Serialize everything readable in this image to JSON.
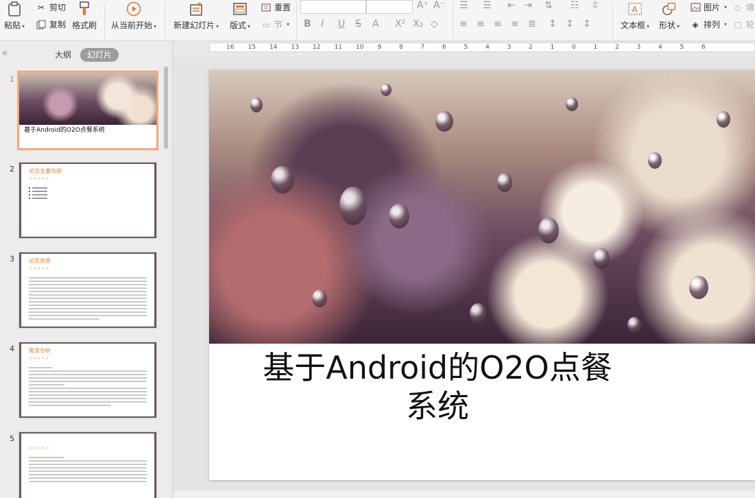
{
  "ribbon": {
    "paste": "粘贴",
    "cut": "剪切",
    "copy": "复制",
    "format_painter": "格式刷",
    "from_current": "从当前开始",
    "new_slide": "新建幻灯片",
    "layout": "版式",
    "reset": "重置",
    "section": "节",
    "font_size_up": "A⁺",
    "font_size_down": "A⁻",
    "text_box": "文本框",
    "shape": "形状",
    "picture": "图片",
    "arrange": "排列",
    "fill_cut": "填",
    "outline_cut": "轮"
  },
  "left_pane": {
    "tab_outline": "大纲",
    "tab_slides": "幻灯片",
    "slides": [
      {
        "num": "1",
        "title": "基于Android的O2O点餐系统"
      },
      {
        "num": "2",
        "title": "论文主要内容",
        "arrows": ">>>>>",
        "bullets": 4
      },
      {
        "num": "3",
        "title": "论文背景",
        "arrows": ">>>>>"
      },
      {
        "num": "4",
        "title": "需求分析",
        "arrows": ">>>>>"
      },
      {
        "num": "5",
        "title": "",
        "arrows": ">>>>>"
      }
    ]
  },
  "ruler": [
    "16",
    "15",
    "14",
    "13",
    "12",
    "11",
    "10",
    "9",
    "8",
    "7",
    "6",
    "5",
    "4",
    "3",
    "2",
    "1",
    "0",
    "1",
    "2",
    "3",
    "4",
    "5",
    "6"
  ],
  "slide": {
    "title_line1": "基于Android的O2O点餐",
    "title_line2": "系统"
  },
  "colors": {
    "accent": "#e2772d",
    "selected_tab": "#9c9c9c"
  }
}
